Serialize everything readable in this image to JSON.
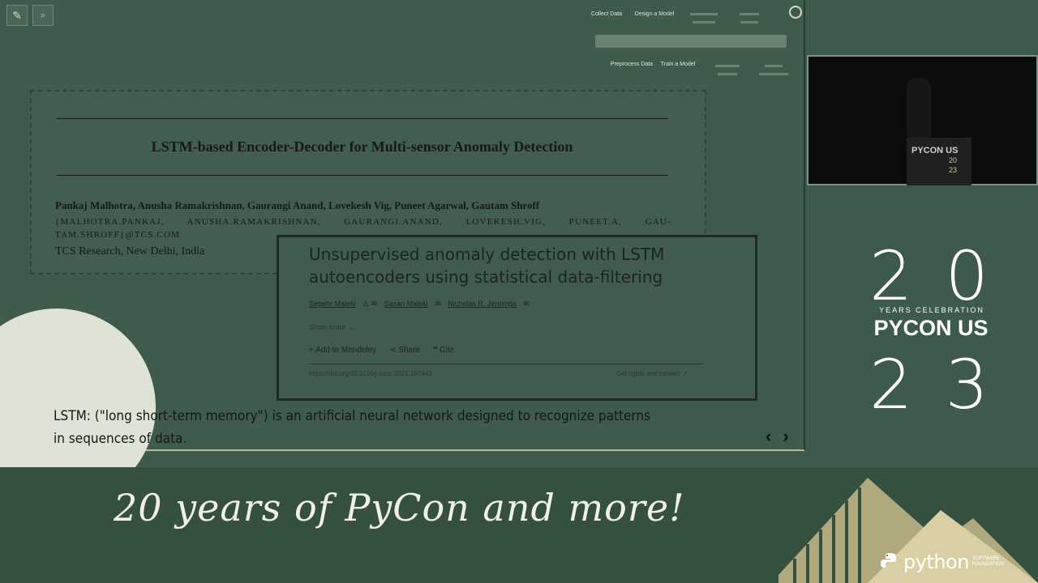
{
  "toolbar": {
    "menu_top": [
      "Collect Data",
      "Design a Model",
      "",
      ""
    ],
    "menu_bottom": [
      "Preprocess Data",
      "Train a Model",
      "",
      ""
    ]
  },
  "paper1": {
    "title": "LSTM-based Encoder-Decoder for Multi-sensor Anomaly Detection",
    "authors": "Pankaj Malhotra, Anusha Ramakrishnan, Gaurangi Anand, Lovekesh Vig, Puneet Agarwal, Gautam Shroff",
    "emails": "{MALHOTRA.PANKAJ, ANUSHA.RAMAKRISHNAN, GAURANGI.ANAND, LOVEKESH.VIG, PUNEET.A, GAU- TAM.SHROFF}@TCS.COM",
    "affiliation": "TCS Research, New Delhi, India"
  },
  "paper2": {
    "title": "Unsupervised anomaly detection with LSTM autoencoders using statistical data-filtering",
    "authors": [
      "Sepehr Maleki",
      "Sasan Maleki",
      "Nicholas R. Jennings"
    ],
    "show_more": "Show more",
    "actions": [
      "Add to Mendeley",
      "Share",
      "Cite"
    ],
    "doi": "https://doi.org/10.1016/j.asoc.2021.107443",
    "rights": "Get rights and content"
  },
  "caption": "LSTM: (\"long short-term memory\") is an artificial neural network designed to recognize patterns in sequences of data.",
  "nav": {
    "prev": "‹",
    "next": "›"
  },
  "podium": {
    "brand": "PYCON US",
    "y1": "20",
    "y2": "23"
  },
  "branding": {
    "year_top": "20",
    "years_celebration": "YEARS CELEBRATION",
    "event": "PYCON US",
    "year_bottom": "23",
    "tagline": "20 years of PyCon and more!",
    "python": "python",
    "python_sub": "SOFTWARE FOUNDATION"
  },
  "colors": {
    "background": "#3e5a4c",
    "accent": "#c5b98a"
  }
}
